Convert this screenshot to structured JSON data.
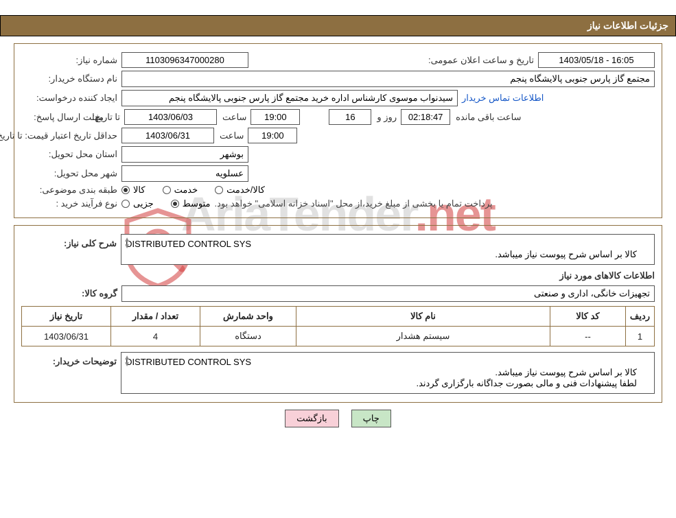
{
  "header": {
    "title": "جزئیات اطلاعات نیاز"
  },
  "form": {
    "need_number_label": "شماره نیاز:",
    "need_number": "1103096347000280",
    "announce_label": "تاریخ و ساعت اعلان عمومی:",
    "announce_value": "1403/05/18 - 16:05",
    "buyer_label": "نام دستگاه خریدار:",
    "buyer_value": "مجتمع گاز پارس جنوبی  پالایشگاه پنجم",
    "requester_label": "ایجاد کننده درخواست:",
    "requester_value": "سیدنواب موسوی کارشناس اداره خرید مجتمع گاز پارس جنوبی  پالایشگاه پنجم",
    "contact_link": "اطلاعات تماس خریدار",
    "deadline_label": "مهلت ارسال پاسخ:",
    "to_date_label": "تا تاریخ:",
    "deadline_date": "1403/06/03",
    "time_label": "ساعت",
    "deadline_time": "19:00",
    "remain_days": "16",
    "days_and_label": "روز و",
    "remain_hms": "02:18:47",
    "remain_suffix": "ساعت باقی مانده",
    "min_validity_label": "حداقل تاریخ اعتبار قیمت:",
    "validity_date": "1403/06/31",
    "validity_time": "19:00",
    "province_label": "استان محل تحویل:",
    "province_value": "بوشهر",
    "city_label": "شهر محل تحویل:",
    "city_value": "عسلویه",
    "subject_label": "طبقه بندی موضوعی:",
    "opt_goods": "کالا",
    "opt_service": "خدمت",
    "opt_goods_service": "کالا/خدمت",
    "purchase_type_label": "نوع فرآیند خرید :",
    "opt_partial": "جزیی",
    "opt_medium": "متوسط",
    "purchase_note": "پرداخت تمام یا بخشی از مبلغ خرید،از محل \"اسناد خزانه اسلامی\" خواهد بود."
  },
  "need": {
    "desc_label": "شرح کلی نیاز:",
    "desc_line1": "DISTRIBUTED CONTROL SYS",
    "desc_line2": "کالا بر اساس شرح پیوست نیاز میباشد.",
    "items_title": "اطلاعات کالاهای مورد نیاز",
    "group_label": "گروه کالا:",
    "group_value": "تجهیزات خانگی، اداری و صنعتی",
    "tbl": {
      "h_row": "ردیف",
      "h_code": "کد کالا",
      "h_name": "نام کالا",
      "h_unit": "واحد شمارش",
      "h_qty": "تعداد / مقدار",
      "h_date": "تاریخ نیاز",
      "r1": {
        "n": "1",
        "code": "--",
        "name": "سیستم هشدار",
        "unit": "دستگاه",
        "qty": "4",
        "date": "1403/06/31"
      }
    },
    "buyer_notes_label": "توضیحات خریدار:",
    "buyer_notes_l1": "DISTRIBUTED CONTROL SYS",
    "buyer_notes_l2": "کالا بر اساس شرح پیوست نیاز میباشد.",
    "buyer_notes_l3": "لطفا پیشنهادات فنی و مالی بصورت جداگانه بارگزاری گردند."
  },
  "buttons": {
    "print": "چاپ",
    "back": "بازگشت"
  },
  "watermark": {
    "t1": "AriaTender",
    "t2": ".net"
  }
}
